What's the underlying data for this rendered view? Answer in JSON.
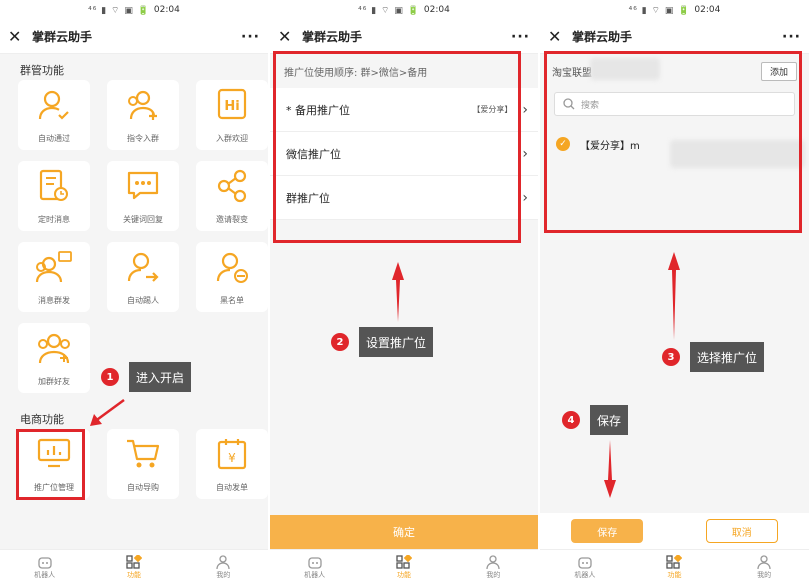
{
  "status": {
    "time": "02:04",
    "icons": "⁴⁶ ▮ ⌔ ▣ 🔋"
  },
  "appbar": {
    "title": "掌群云助手",
    "more": "···",
    "close": "✕"
  },
  "panel1": {
    "section_group": "群管功能",
    "group_tiles": [
      {
        "label": "自动通过",
        "icon": "user-check-icon"
      },
      {
        "label": "指令入群",
        "icon": "users-add-icon"
      },
      {
        "label": "入群欢迎",
        "icon": "hi-icon"
      },
      {
        "label": "定时消息",
        "icon": "doc-clock-icon"
      },
      {
        "label": "关键词回复",
        "icon": "chat-dots-icon"
      },
      {
        "label": "邀请裂变",
        "icon": "share-icon"
      },
      {
        "label": "消息群发",
        "icon": "group-message-icon"
      },
      {
        "label": "自动踢人",
        "icon": "user-kick-icon"
      },
      {
        "label": "黑名单",
        "icon": "user-block-icon"
      },
      {
        "label": "加群好友",
        "icon": "group-add-icon"
      }
    ],
    "section_ecom": "电商功能",
    "ecom_tiles": [
      {
        "label": "推广位管理",
        "icon": "monitor-chart-icon"
      },
      {
        "label": "自动导购",
        "icon": "cart-icon"
      },
      {
        "label": "自动发单",
        "icon": "calendar-yen-icon"
      }
    ]
  },
  "panel2": {
    "order_text": "推广位使用顺序: 群>微信>备用",
    "rows": [
      {
        "label": "* 备用推广位",
        "tag": "【爱分享】"
      },
      {
        "label": "微信推广位",
        "tag": ""
      },
      {
        "label": "群推广位",
        "tag": ""
      }
    ],
    "confirm": "确定"
  },
  "panel3": {
    "header_label": "淘宝联盟",
    "add": "添加",
    "search_placeholder": "搜索",
    "item_label": "【爱分享】m",
    "save": "保存",
    "cancel": "取消"
  },
  "tabs": [
    {
      "label": "机器人",
      "icon": "robot-icon"
    },
    {
      "label": "功能",
      "icon": "grid-icon"
    },
    {
      "label": "我的",
      "icon": "person-icon"
    }
  ],
  "annotations": {
    "step1": {
      "num": "1",
      "text": "进入开启"
    },
    "step2": {
      "num": "2",
      "text": "设置推广位"
    },
    "step3": {
      "num": "3",
      "text": "选择推广位"
    },
    "step4": {
      "num": "4",
      "text": "保存"
    }
  },
  "colors": {
    "accent": "#f5a623",
    "annotation_red": "#e0262b",
    "callout_bg": "#555555"
  }
}
